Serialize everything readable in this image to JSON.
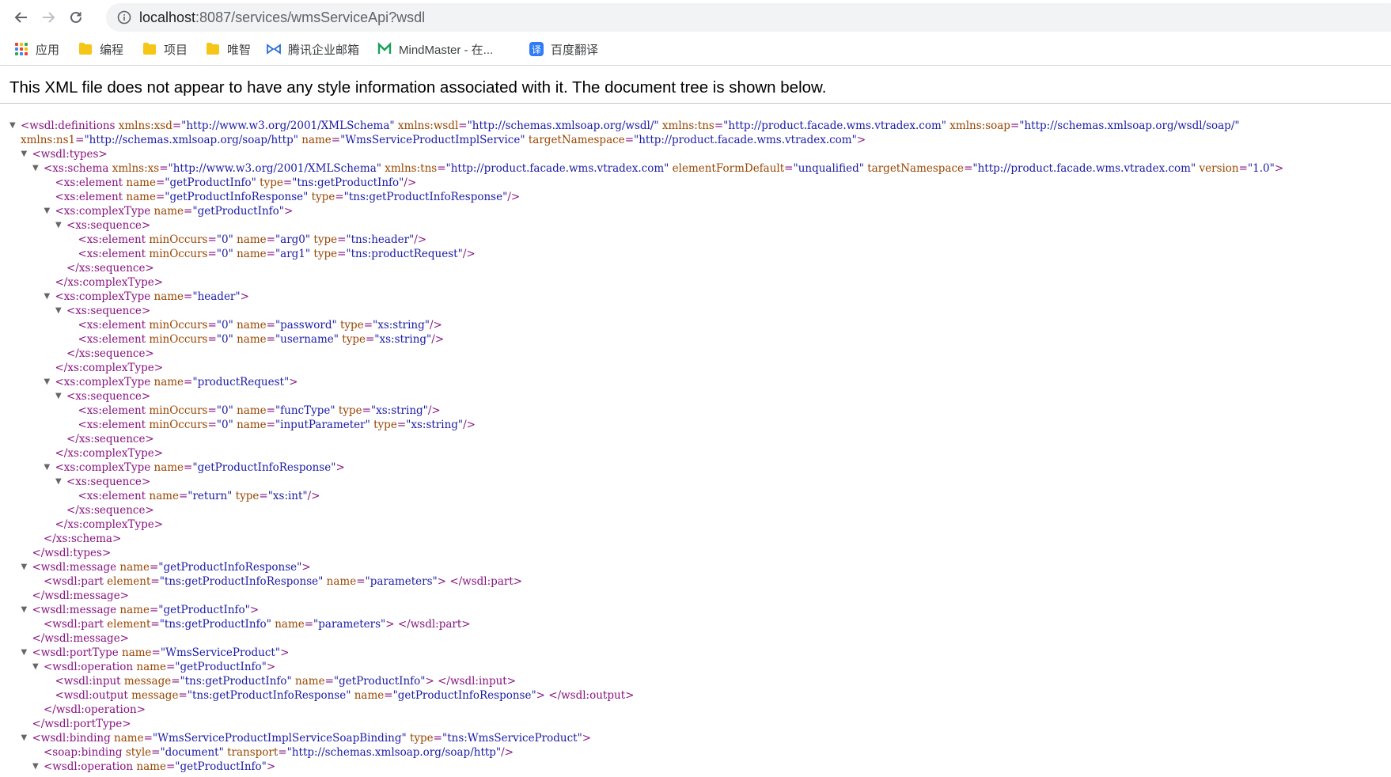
{
  "browser": {
    "url_host": "localhost",
    "url_rest": ":8087/services/wmsServiceApi?wsdl"
  },
  "bookmarks": [
    {
      "label": "应用",
      "icon": "apps-grid-icon"
    },
    {
      "label": "编程",
      "icon": "folder-icon"
    },
    {
      "label": "项目",
      "icon": "folder-icon"
    },
    {
      "label": "唯智",
      "icon": "folder-icon"
    },
    {
      "label": "腾讯企业邮箱",
      "icon": "tencent-mail-icon"
    },
    {
      "label": "MindMaster - 在...",
      "icon": "mindmaster-icon"
    },
    {
      "label": "百度翻译",
      "icon": "baidu-translate-icon"
    }
  ],
  "notice": "This XML file does not appear to have any style information associated with it. The document tree is shown below.",
  "colors": {
    "tag": "#881280",
    "attr_name": "#994500",
    "attr_value": "#1a1aa6",
    "toggle": "#666666"
  },
  "xml_lines": [
    {
      "indent": 0,
      "toggle": true,
      "parts": [
        [
          "t",
          "<wsdl:definitions"
        ],
        [
          "a",
          " xmlns:xsd"
        ],
        [
          "p",
          "="
        ],
        [
          "v",
          "\"http://www.w3.org/2001/XMLSchema\""
        ],
        [
          "a",
          " xmlns:wsdl"
        ],
        [
          "p",
          "="
        ],
        [
          "v",
          "\"http://schemas.xmlsoap.org/wsdl/\""
        ],
        [
          "a",
          " xmlns:tns"
        ],
        [
          "p",
          "="
        ],
        [
          "v",
          "\"http://product.facade.wms.vtradex.com\""
        ],
        [
          "a",
          " xmlns:soap"
        ],
        [
          "p",
          "="
        ],
        [
          "v",
          "\"http://schemas.xmlsoap.org/wsdl/soap/\""
        ]
      ]
    },
    {
      "indent": 0,
      "toggle": false,
      "parts": [
        [
          "a",
          "xmlns:ns1"
        ],
        [
          "p",
          "="
        ],
        [
          "v",
          "\"http://schemas.xmlsoap.org/soap/http\""
        ],
        [
          "a",
          " name"
        ],
        [
          "p",
          "="
        ],
        [
          "v",
          "\"WmsServiceProductImplService\""
        ],
        [
          "a",
          " targetNamespace"
        ],
        [
          "p",
          "="
        ],
        [
          "v",
          "\"http://product.facade.wms.vtradex.com\""
        ],
        [
          "t",
          ">"
        ]
      ]
    },
    {
      "indent": 1,
      "toggle": true,
      "parts": [
        [
          "t",
          "<wsdl:types>"
        ]
      ]
    },
    {
      "indent": 2,
      "toggle": true,
      "parts": [
        [
          "t",
          "<xs:schema"
        ],
        [
          "a",
          " xmlns:xs"
        ],
        [
          "p",
          "="
        ],
        [
          "v",
          "\"http://www.w3.org/2001/XMLSchema\""
        ],
        [
          "a",
          " xmlns:tns"
        ],
        [
          "p",
          "="
        ],
        [
          "v",
          "\"http://product.facade.wms.vtradex.com\""
        ],
        [
          "a",
          " elementFormDefault"
        ],
        [
          "p",
          "="
        ],
        [
          "v",
          "\"unqualified\""
        ],
        [
          "a",
          " targetNamespace"
        ],
        [
          "p",
          "="
        ],
        [
          "v",
          "\"http://product.facade.wms.vtradex.com\""
        ],
        [
          "a",
          " version"
        ],
        [
          "p",
          "="
        ],
        [
          "v",
          "\"1.0\""
        ],
        [
          "t",
          ">"
        ]
      ]
    },
    {
      "indent": 3,
      "toggle": false,
      "parts": [
        [
          "t",
          "<xs:element"
        ],
        [
          "a",
          " name"
        ],
        [
          "p",
          "="
        ],
        [
          "v",
          "\"getProductInfo\""
        ],
        [
          "a",
          " type"
        ],
        [
          "p",
          "="
        ],
        [
          "v",
          "\"tns:getProductInfo\""
        ],
        [
          "t",
          "/>"
        ]
      ]
    },
    {
      "indent": 3,
      "toggle": false,
      "parts": [
        [
          "t",
          "<xs:element"
        ],
        [
          "a",
          " name"
        ],
        [
          "p",
          "="
        ],
        [
          "v",
          "\"getProductInfoResponse\""
        ],
        [
          "a",
          " type"
        ],
        [
          "p",
          "="
        ],
        [
          "v",
          "\"tns:getProductInfoResponse\""
        ],
        [
          "t",
          "/>"
        ]
      ]
    },
    {
      "indent": 3,
      "toggle": true,
      "parts": [
        [
          "t",
          "<xs:complexType"
        ],
        [
          "a",
          " name"
        ],
        [
          "p",
          "="
        ],
        [
          "v",
          "\"getProductInfo\""
        ],
        [
          "t",
          ">"
        ]
      ]
    },
    {
      "indent": 4,
      "toggle": true,
      "parts": [
        [
          "t",
          "<xs:sequence>"
        ]
      ]
    },
    {
      "indent": 5,
      "toggle": false,
      "parts": [
        [
          "t",
          "<xs:element"
        ],
        [
          "a",
          " minOccurs"
        ],
        [
          "p",
          "="
        ],
        [
          "v",
          "\"0\""
        ],
        [
          "a",
          " name"
        ],
        [
          "p",
          "="
        ],
        [
          "v",
          "\"arg0\""
        ],
        [
          "a",
          " type"
        ],
        [
          "p",
          "="
        ],
        [
          "v",
          "\"tns:header\""
        ],
        [
          "t",
          "/>"
        ]
      ]
    },
    {
      "indent": 5,
      "toggle": false,
      "parts": [
        [
          "t",
          "<xs:element"
        ],
        [
          "a",
          " minOccurs"
        ],
        [
          "p",
          "="
        ],
        [
          "v",
          "\"0\""
        ],
        [
          "a",
          " name"
        ],
        [
          "p",
          "="
        ],
        [
          "v",
          "\"arg1\""
        ],
        [
          "a",
          " type"
        ],
        [
          "p",
          "="
        ],
        [
          "v",
          "\"tns:productRequest\""
        ],
        [
          "t",
          "/>"
        ]
      ]
    },
    {
      "indent": 4,
      "toggle": false,
      "parts": [
        [
          "t",
          "</xs:sequence>"
        ]
      ]
    },
    {
      "indent": 3,
      "toggle": false,
      "parts": [
        [
          "t",
          "</xs:complexType>"
        ]
      ]
    },
    {
      "indent": 3,
      "toggle": true,
      "parts": [
        [
          "t",
          "<xs:complexType"
        ],
        [
          "a",
          " name"
        ],
        [
          "p",
          "="
        ],
        [
          "v",
          "\"header\""
        ],
        [
          "t",
          ">"
        ]
      ]
    },
    {
      "indent": 4,
      "toggle": true,
      "parts": [
        [
          "t",
          "<xs:sequence>"
        ]
      ]
    },
    {
      "indent": 5,
      "toggle": false,
      "parts": [
        [
          "t",
          "<xs:element"
        ],
        [
          "a",
          " minOccurs"
        ],
        [
          "p",
          "="
        ],
        [
          "v",
          "\"0\""
        ],
        [
          "a",
          " name"
        ],
        [
          "p",
          "="
        ],
        [
          "v",
          "\"password\""
        ],
        [
          "a",
          " type"
        ],
        [
          "p",
          "="
        ],
        [
          "v",
          "\"xs:string\""
        ],
        [
          "t",
          "/>"
        ]
      ]
    },
    {
      "indent": 5,
      "toggle": false,
      "parts": [
        [
          "t",
          "<xs:element"
        ],
        [
          "a",
          " minOccurs"
        ],
        [
          "p",
          "="
        ],
        [
          "v",
          "\"0\""
        ],
        [
          "a",
          " name"
        ],
        [
          "p",
          "="
        ],
        [
          "v",
          "\"username\""
        ],
        [
          "a",
          " type"
        ],
        [
          "p",
          "="
        ],
        [
          "v",
          "\"xs:string\""
        ],
        [
          "t",
          "/>"
        ]
      ]
    },
    {
      "indent": 4,
      "toggle": false,
      "parts": [
        [
          "t",
          "</xs:sequence>"
        ]
      ]
    },
    {
      "indent": 3,
      "toggle": false,
      "parts": [
        [
          "t",
          "</xs:complexType>"
        ]
      ]
    },
    {
      "indent": 3,
      "toggle": true,
      "parts": [
        [
          "t",
          "<xs:complexType"
        ],
        [
          "a",
          " name"
        ],
        [
          "p",
          "="
        ],
        [
          "v",
          "\"productRequest\""
        ],
        [
          "t",
          ">"
        ]
      ]
    },
    {
      "indent": 4,
      "toggle": true,
      "parts": [
        [
          "t",
          "<xs:sequence>"
        ]
      ]
    },
    {
      "indent": 5,
      "toggle": false,
      "parts": [
        [
          "t",
          "<xs:element"
        ],
        [
          "a",
          " minOccurs"
        ],
        [
          "p",
          "="
        ],
        [
          "v",
          "\"0\""
        ],
        [
          "a",
          " name"
        ],
        [
          "p",
          "="
        ],
        [
          "v",
          "\"funcType\""
        ],
        [
          "a",
          " type"
        ],
        [
          "p",
          "="
        ],
        [
          "v",
          "\"xs:string\""
        ],
        [
          "t",
          "/>"
        ]
      ]
    },
    {
      "indent": 5,
      "toggle": false,
      "parts": [
        [
          "t",
          "<xs:element"
        ],
        [
          "a",
          " minOccurs"
        ],
        [
          "p",
          "="
        ],
        [
          "v",
          "\"0\""
        ],
        [
          "a",
          " name"
        ],
        [
          "p",
          "="
        ],
        [
          "v",
          "\"inputParameter\""
        ],
        [
          "a",
          " type"
        ],
        [
          "p",
          "="
        ],
        [
          "v",
          "\"xs:string\""
        ],
        [
          "t",
          "/>"
        ]
      ]
    },
    {
      "indent": 4,
      "toggle": false,
      "parts": [
        [
          "t",
          "</xs:sequence>"
        ]
      ]
    },
    {
      "indent": 3,
      "toggle": false,
      "parts": [
        [
          "t",
          "</xs:complexType>"
        ]
      ]
    },
    {
      "indent": 3,
      "toggle": true,
      "parts": [
        [
          "t",
          "<xs:complexType"
        ],
        [
          "a",
          " name"
        ],
        [
          "p",
          "="
        ],
        [
          "v",
          "\"getProductInfoResponse\""
        ],
        [
          "t",
          ">"
        ]
      ]
    },
    {
      "indent": 4,
      "toggle": true,
      "parts": [
        [
          "t",
          "<xs:sequence>"
        ]
      ]
    },
    {
      "indent": 5,
      "toggle": false,
      "parts": [
        [
          "t",
          "<xs:element"
        ],
        [
          "a",
          " name"
        ],
        [
          "p",
          "="
        ],
        [
          "v",
          "\"return\""
        ],
        [
          "a",
          " type"
        ],
        [
          "p",
          "="
        ],
        [
          "v",
          "\"xs:int\""
        ],
        [
          "t",
          "/>"
        ]
      ]
    },
    {
      "indent": 4,
      "toggle": false,
      "parts": [
        [
          "t",
          "</xs:sequence>"
        ]
      ]
    },
    {
      "indent": 3,
      "toggle": false,
      "parts": [
        [
          "t",
          "</xs:complexType>"
        ]
      ]
    },
    {
      "indent": 2,
      "toggle": false,
      "parts": [
        [
          "t",
          "</xs:schema>"
        ]
      ]
    },
    {
      "indent": 1,
      "toggle": false,
      "parts": [
        [
          "t",
          "</wsdl:types>"
        ]
      ]
    },
    {
      "indent": 1,
      "toggle": true,
      "parts": [
        [
          "t",
          "<wsdl:message"
        ],
        [
          "a",
          " name"
        ],
        [
          "p",
          "="
        ],
        [
          "v",
          "\"getProductInfoResponse\""
        ],
        [
          "t",
          ">"
        ]
      ]
    },
    {
      "indent": 2,
      "toggle": false,
      "parts": [
        [
          "t",
          "<wsdl:part"
        ],
        [
          "a",
          " element"
        ],
        [
          "p",
          "="
        ],
        [
          "v",
          "\"tns:getProductInfoResponse\""
        ],
        [
          "a",
          " name"
        ],
        [
          "p",
          "="
        ],
        [
          "v",
          "\"parameters\""
        ],
        [
          "t",
          "> </wsdl:part>"
        ]
      ]
    },
    {
      "indent": 1,
      "toggle": false,
      "parts": [
        [
          "t",
          "</wsdl:message>"
        ]
      ]
    },
    {
      "indent": 1,
      "toggle": true,
      "parts": [
        [
          "t",
          "<wsdl:message"
        ],
        [
          "a",
          " name"
        ],
        [
          "p",
          "="
        ],
        [
          "v",
          "\"getProductInfo\""
        ],
        [
          "t",
          ">"
        ]
      ]
    },
    {
      "indent": 2,
      "toggle": false,
      "parts": [
        [
          "t",
          "<wsdl:part"
        ],
        [
          "a",
          " element"
        ],
        [
          "p",
          "="
        ],
        [
          "v",
          "\"tns:getProductInfo\""
        ],
        [
          "a",
          " name"
        ],
        [
          "p",
          "="
        ],
        [
          "v",
          "\"parameters\""
        ],
        [
          "t",
          "> </wsdl:part>"
        ]
      ]
    },
    {
      "indent": 1,
      "toggle": false,
      "parts": [
        [
          "t",
          "</wsdl:message>"
        ]
      ]
    },
    {
      "indent": 1,
      "toggle": true,
      "parts": [
        [
          "t",
          "<wsdl:portType"
        ],
        [
          "a",
          " name"
        ],
        [
          "p",
          "="
        ],
        [
          "v",
          "\"WmsServiceProduct\""
        ],
        [
          "t",
          ">"
        ]
      ]
    },
    {
      "indent": 2,
      "toggle": true,
      "parts": [
        [
          "t",
          "<wsdl:operation"
        ],
        [
          "a",
          " name"
        ],
        [
          "p",
          "="
        ],
        [
          "v",
          "\"getProductInfo\""
        ],
        [
          "t",
          ">"
        ]
      ]
    },
    {
      "indent": 3,
      "toggle": false,
      "parts": [
        [
          "t",
          "<wsdl:input"
        ],
        [
          "a",
          " message"
        ],
        [
          "p",
          "="
        ],
        [
          "v",
          "\"tns:getProductInfo\""
        ],
        [
          "a",
          " name"
        ],
        [
          "p",
          "="
        ],
        [
          "v",
          "\"getProductInfo\""
        ],
        [
          "t",
          "> </wsdl:input>"
        ]
      ]
    },
    {
      "indent": 3,
      "toggle": false,
      "parts": [
        [
          "t",
          "<wsdl:output"
        ],
        [
          "a",
          " message"
        ],
        [
          "p",
          "="
        ],
        [
          "v",
          "\"tns:getProductInfoResponse\""
        ],
        [
          "a",
          " name"
        ],
        [
          "p",
          "="
        ],
        [
          "v",
          "\"getProductInfoResponse\""
        ],
        [
          "t",
          "> </wsdl:output>"
        ]
      ]
    },
    {
      "indent": 2,
      "toggle": false,
      "parts": [
        [
          "t",
          "</wsdl:operation>"
        ]
      ]
    },
    {
      "indent": 1,
      "toggle": false,
      "parts": [
        [
          "t",
          "</wsdl:portType>"
        ]
      ]
    },
    {
      "indent": 1,
      "toggle": true,
      "parts": [
        [
          "t",
          "<wsdl:binding"
        ],
        [
          "a",
          " name"
        ],
        [
          "p",
          "="
        ],
        [
          "v",
          "\"WmsServiceProductImplServiceSoapBinding\""
        ],
        [
          "a",
          " type"
        ],
        [
          "p",
          "="
        ],
        [
          "v",
          "\"tns:WmsServiceProduct\""
        ],
        [
          "t",
          ">"
        ]
      ]
    },
    {
      "indent": 2,
      "toggle": false,
      "parts": [
        [
          "t",
          "<soap:binding"
        ],
        [
          "a",
          " style"
        ],
        [
          "p",
          "="
        ],
        [
          "v",
          "\"document\""
        ],
        [
          "a",
          " transport"
        ],
        [
          "p",
          "="
        ],
        [
          "v",
          "\"http://schemas.xmlsoap.org/soap/http\""
        ],
        [
          "t",
          "/>"
        ]
      ]
    },
    {
      "indent": 2,
      "toggle": true,
      "parts": [
        [
          "t",
          "<wsdl:operation"
        ],
        [
          "a",
          " name"
        ],
        [
          "p",
          "="
        ],
        [
          "v",
          "\"getProductInfo\""
        ],
        [
          "t",
          ">"
        ]
      ]
    }
  ]
}
